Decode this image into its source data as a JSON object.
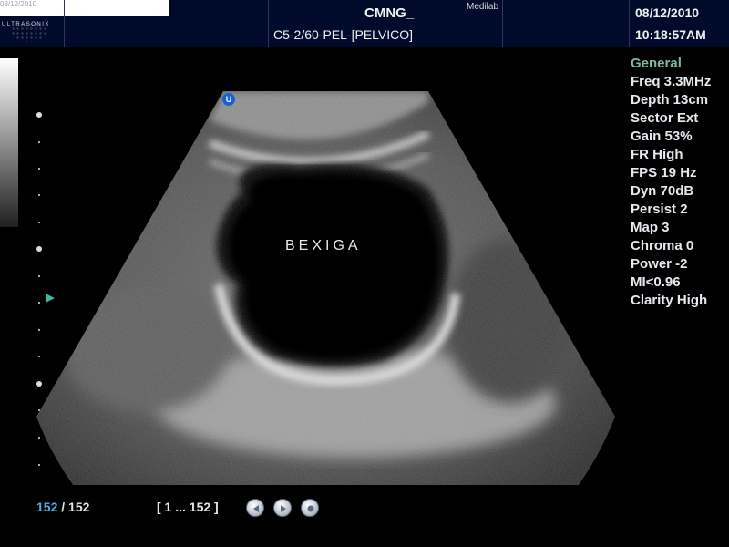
{
  "header": {
    "logo_date": "08/12/2010",
    "logo_text": "ULTRASONIX",
    "title": "CMNG_",
    "brand": "Medilab",
    "probe_preset": "C5-2/60-PEL-[PELVICO]",
    "date": "08/12/2010",
    "time": "10:18:57AM"
  },
  "image": {
    "orientation_marker": "U",
    "annotation": "BEXIGA"
  },
  "params": {
    "mode": "General",
    "items": [
      "Freq 3.3MHz",
      "Depth 13cm",
      "Sector Ext",
      "Gain 53%",
      "FR High",
      "FPS 19 Hz",
      "Dyn 70dB",
      "Persist 2",
      "Map 3",
      "Chroma 0",
      "Power -2",
      "MI<0.96",
      "Clarity High"
    ]
  },
  "footer": {
    "current_frame": "152",
    "separator": "/",
    "total_frames": "152",
    "range": "[ 1 ... 152 ]"
  },
  "icons": [
    "play-back-icon",
    "play-forward-icon",
    "stop-icon",
    "orientation-marker-icon",
    "focus-marker-icon"
  ],
  "colors": {
    "mode_accent": "#7fb89a",
    "frame_current": "#4ab0e8",
    "header_bg": "#000a2a",
    "orientation_marker": "#1a5ed8",
    "focus_marker": "#3fb8a0"
  }
}
